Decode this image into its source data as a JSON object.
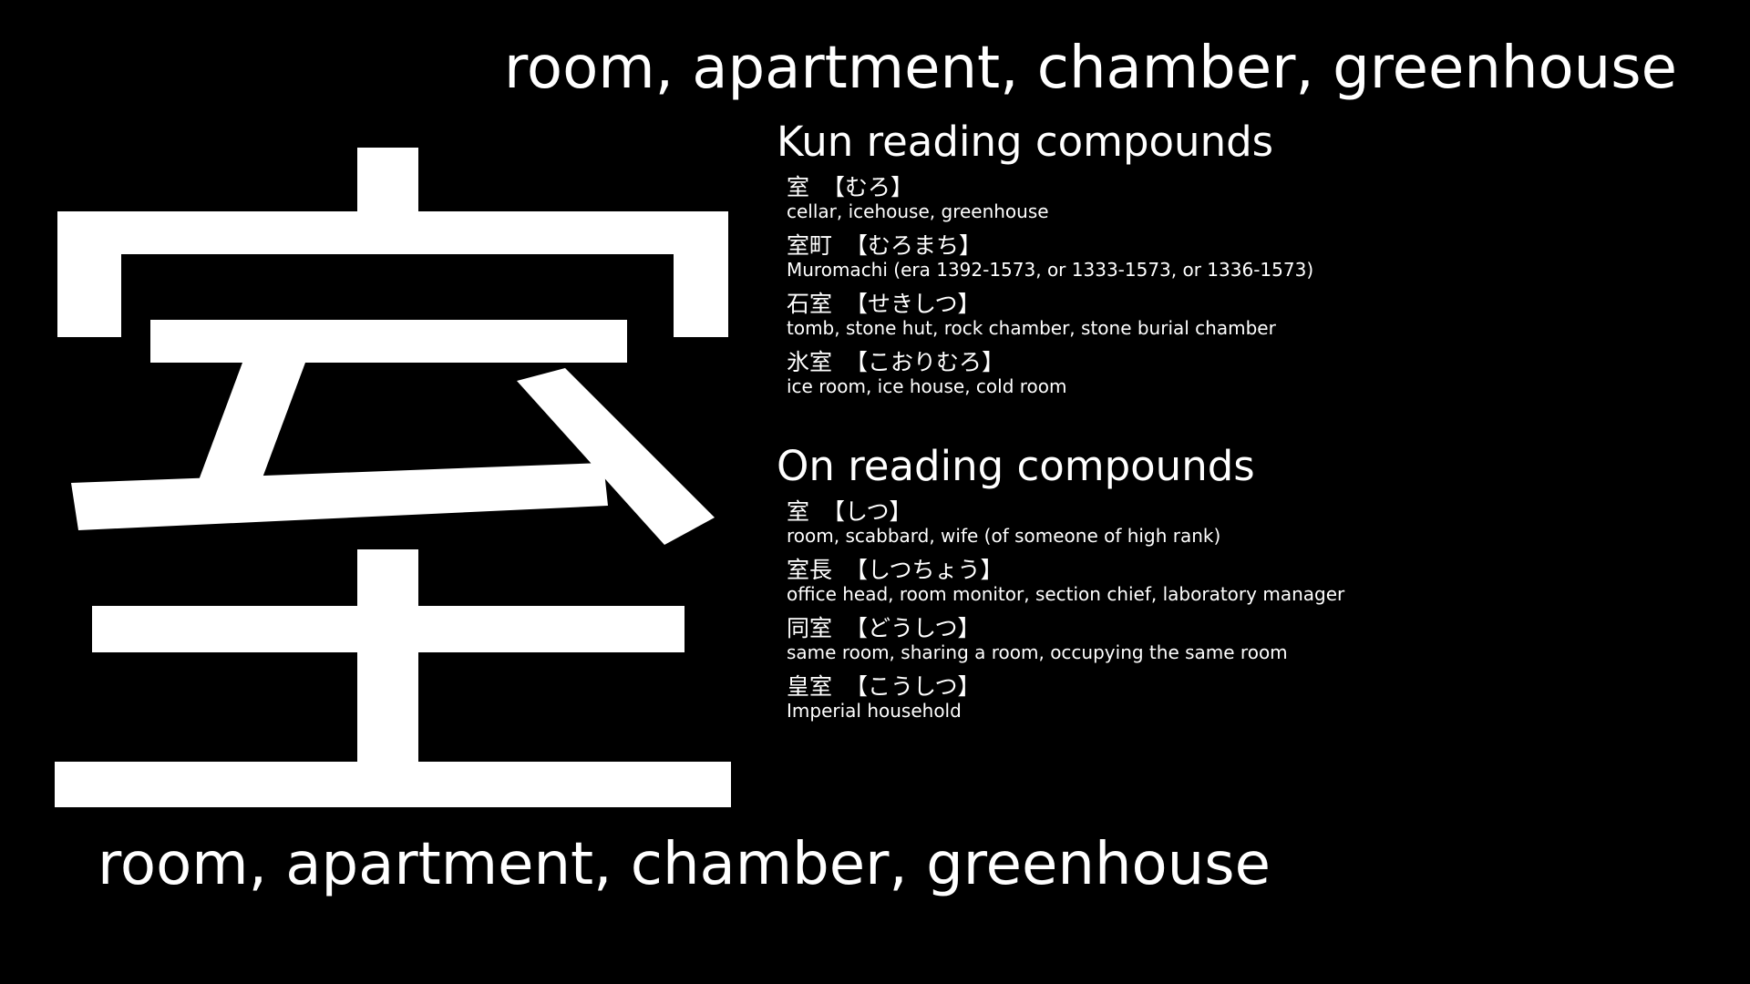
{
  "kanji": {
    "character": "室",
    "icon": "kanji-shitsu-glyph"
  },
  "meaning_top": "room, apartment, chamber, greenhouse",
  "meaning_bottom": "room, apartment, chamber, greenhouse",
  "kun": {
    "title": "Kun reading compounds",
    "compounds": [
      {
        "word": "室",
        "reading": "【むろ】",
        "gloss": "cellar, icehouse, greenhouse"
      },
      {
        "word": "室町",
        "reading": "【むろまち】",
        "gloss": "Muromachi (era 1392-1573, or 1333-1573, or 1336-1573)"
      },
      {
        "word": "石室",
        "reading": "【せきしつ】",
        "gloss": "tomb, stone hut, rock chamber, stone burial chamber"
      },
      {
        "word": "氷室",
        "reading": "【こおりむろ】",
        "gloss": "ice room, ice house, cold room"
      }
    ]
  },
  "on": {
    "title": "On reading compounds",
    "compounds": [
      {
        "word": "室",
        "reading": "【しつ】",
        "gloss": "room, scabbard, wife (of someone of high rank)"
      },
      {
        "word": "室長",
        "reading": "【しつちょう】",
        "gloss": "office head, room monitor, section chief, laboratory manager"
      },
      {
        "word": "同室",
        "reading": "【どうしつ】",
        "gloss": "same room, sharing a room, occupying the same room"
      },
      {
        "word": "皇室",
        "reading": "【こうしつ】",
        "gloss": "Imperial household"
      }
    ]
  },
  "colors": {
    "background": "#000000",
    "foreground": "#ffffff"
  }
}
